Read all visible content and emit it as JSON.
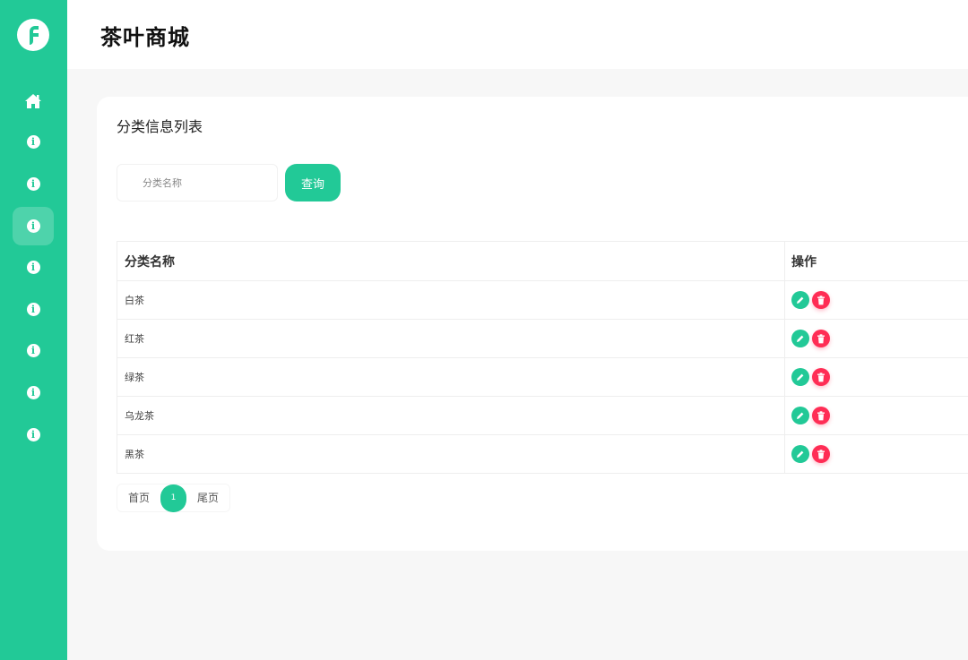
{
  "header": {
    "title": "茶叶商城"
  },
  "sidebar": {
    "items": [
      {
        "icon": "home-icon"
      },
      {
        "icon": "info-icon"
      },
      {
        "icon": "info-icon"
      },
      {
        "icon": "info-icon",
        "active": true
      },
      {
        "icon": "info-icon"
      },
      {
        "icon": "info-icon"
      },
      {
        "icon": "info-icon"
      },
      {
        "icon": "info-icon"
      },
      {
        "icon": "info-icon"
      }
    ]
  },
  "card": {
    "title": "分类信息列表",
    "search": {
      "placeholder": "分类名称",
      "value": "",
      "button_label": "查询"
    }
  },
  "table": {
    "columns": [
      "分类名称",
      "操作"
    ],
    "rows": [
      {
        "name": "白茶"
      },
      {
        "name": "红茶"
      },
      {
        "name": "绿茶"
      },
      {
        "name": "乌龙茶"
      },
      {
        "name": "黑茶"
      }
    ]
  },
  "pagination": {
    "first_label": "首页",
    "current_page": "1",
    "last_label": "尾页"
  },
  "colors": {
    "accent": "#22c997",
    "danger": "#ff2d55",
    "background": "#f7f7f7"
  }
}
